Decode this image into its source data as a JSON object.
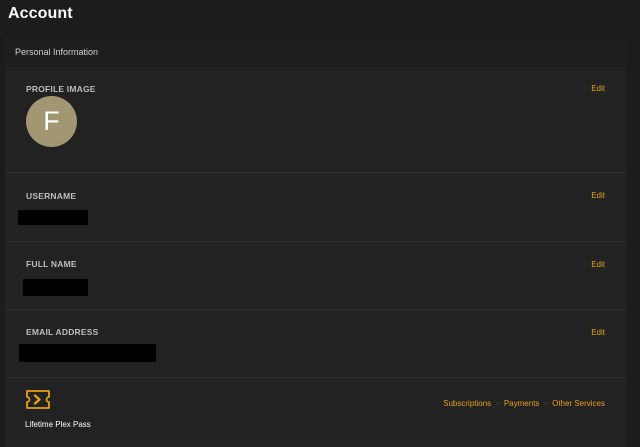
{
  "page": {
    "title": "Account"
  },
  "personal_info": {
    "header": "Personal Information",
    "profile_image": {
      "label": "PROFILE IMAGE",
      "edit": "Edit",
      "avatar_letter": "F",
      "avatar_color": "#a39672"
    },
    "username": {
      "label": "USERNAME",
      "edit": "Edit"
    },
    "full_name": {
      "label": "FULL NAME",
      "edit": "Edit"
    },
    "email": {
      "label": "EMAIL ADDRESS",
      "edit": "Edit"
    }
  },
  "plex_pass": {
    "label": "Lifetime Plex Pass",
    "icon": "plex-pass-chevron-icon",
    "links": {
      "subscriptions": "Subscriptions",
      "payments": "Payments",
      "other_services": "Other Services",
      "separator": "·"
    }
  },
  "colors": {
    "accent": "#e5a00d",
    "background": "#1c1c1c",
    "panel": "#222222"
  }
}
